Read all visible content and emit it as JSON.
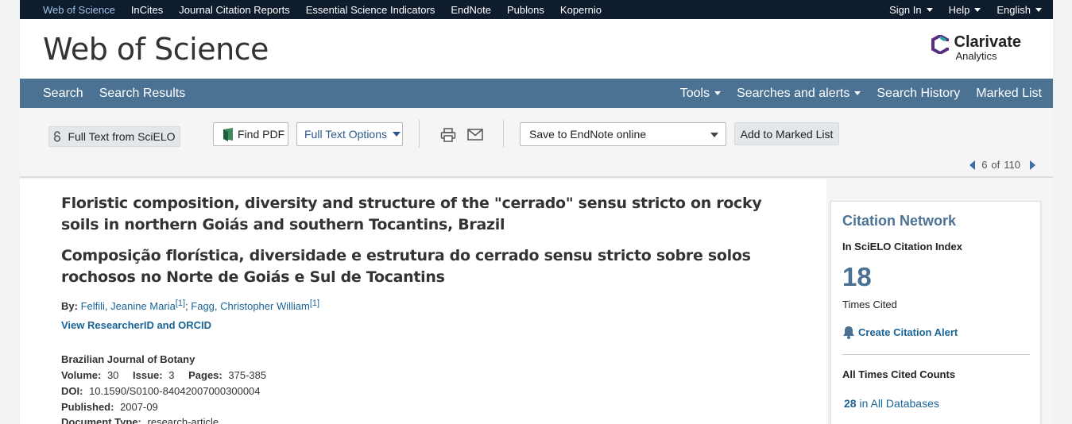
{
  "topbar": {
    "links": [
      "Web of Science",
      "InCites",
      "Journal Citation Reports",
      "Essential Science Indicators",
      "EndNote",
      "Publons",
      "Kopernio"
    ],
    "sign_in": "Sign In",
    "help": "Help",
    "language": "English"
  },
  "header": {
    "brand": "Web of Science",
    "vendor_name": "Clarivate",
    "vendor_sub": "Analytics"
  },
  "nav": {
    "search": "Search",
    "search_results": "Search Results",
    "tools": "Tools",
    "searches_alerts": "Searches and alerts",
    "search_history": "Search History",
    "marked_list": "Marked List"
  },
  "toolbar": {
    "full_text_scielo": "Full Text from SciELO",
    "find_pdf": "Find PDF",
    "full_text_options": "Full Text Options",
    "save_select": "Save to EndNote online",
    "add_marked": "Add to Marked List",
    "pager_current": "6",
    "pager_of": "of",
    "pager_total": "110"
  },
  "record": {
    "title_en": "Floristic composition, diversity and structure of the \"cerrado\" sensu stricto on rocky soils in northern Goiás and southern Tocantins, Brazil",
    "title_pt": "Composição florística, diversidade e estrutura do cerrado sensu stricto sobre solos rochosos no Norte de Goiás e Sul de Tocantins",
    "by_label": "By:",
    "author1": "Felfili, Jeanine Maria",
    "author1_ref": "[1]",
    "author_sep": ";",
    "author2": "Fagg, Christopher William",
    "author2_ref": "[1]",
    "researcher_link": "View ResearcherID and ORCID",
    "journal": "Brazilian Journal of Botany",
    "volume_label": "Volume:",
    "volume": "30",
    "issue_label": "Issue:",
    "issue": "3",
    "pages_label": "Pages:",
    "pages": "375-385",
    "doi_label": "DOI:",
    "doi": "10.1590/S0100-84042007000300004",
    "published_label": "Published:",
    "published": "2007-09",
    "doctype_label": "Document Type:",
    "doctype": "research-article"
  },
  "citation_network": {
    "title": "Citation Network",
    "index_label": "In SciELO Citation Index",
    "times_cited": "18",
    "times_cited_label": "Times Cited",
    "create_alert": "Create Citation Alert",
    "all_counts_label": "All Times Cited Counts",
    "all_db_count": "28",
    "all_db_label": "in All Databases"
  },
  "colors": {
    "nav_blue": "#4b7193",
    "topbar": "#0f1c2e",
    "link": "#1a6496"
  }
}
